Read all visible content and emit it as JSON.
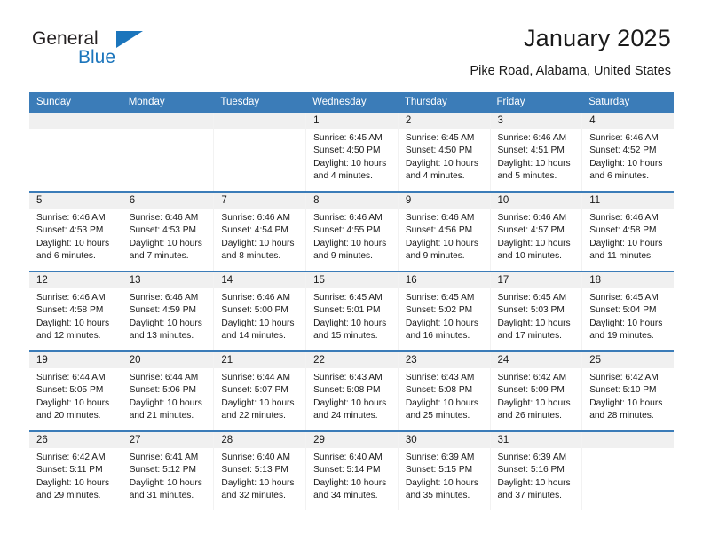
{
  "brand": {
    "name_dark": "General",
    "name_blue": "Blue",
    "accent_color": "#1b75bc"
  },
  "header": {
    "title": "January 2025",
    "location": "Pike Road, Alabama, United States"
  },
  "calendar": {
    "header_bg": "#3b7cb8",
    "daynum_bg": "#f0f0f0",
    "weekdays": [
      "Sunday",
      "Monday",
      "Tuesday",
      "Wednesday",
      "Thursday",
      "Friday",
      "Saturday"
    ],
    "weeks": [
      [
        {
          "day": "",
          "sunrise": "",
          "sunset": "",
          "daylight": "",
          "empty": true
        },
        {
          "day": "",
          "sunrise": "",
          "sunset": "",
          "daylight": "",
          "empty": true
        },
        {
          "day": "",
          "sunrise": "",
          "sunset": "",
          "daylight": "",
          "empty": true
        },
        {
          "day": "1",
          "sunrise": "Sunrise: 6:45 AM",
          "sunset": "Sunset: 4:50 PM",
          "daylight": "Daylight: 10 hours and 4 minutes."
        },
        {
          "day": "2",
          "sunrise": "Sunrise: 6:45 AM",
          "sunset": "Sunset: 4:50 PM",
          "daylight": "Daylight: 10 hours and 4 minutes."
        },
        {
          "day": "3",
          "sunrise": "Sunrise: 6:46 AM",
          "sunset": "Sunset: 4:51 PM",
          "daylight": "Daylight: 10 hours and 5 minutes."
        },
        {
          "day": "4",
          "sunrise": "Sunrise: 6:46 AM",
          "sunset": "Sunset: 4:52 PM",
          "daylight": "Daylight: 10 hours and 6 minutes."
        }
      ],
      [
        {
          "day": "5",
          "sunrise": "Sunrise: 6:46 AM",
          "sunset": "Sunset: 4:53 PM",
          "daylight": "Daylight: 10 hours and 6 minutes."
        },
        {
          "day": "6",
          "sunrise": "Sunrise: 6:46 AM",
          "sunset": "Sunset: 4:53 PM",
          "daylight": "Daylight: 10 hours and 7 minutes."
        },
        {
          "day": "7",
          "sunrise": "Sunrise: 6:46 AM",
          "sunset": "Sunset: 4:54 PM",
          "daylight": "Daylight: 10 hours and 8 minutes."
        },
        {
          "day": "8",
          "sunrise": "Sunrise: 6:46 AM",
          "sunset": "Sunset: 4:55 PM",
          "daylight": "Daylight: 10 hours and 9 minutes."
        },
        {
          "day": "9",
          "sunrise": "Sunrise: 6:46 AM",
          "sunset": "Sunset: 4:56 PM",
          "daylight": "Daylight: 10 hours and 9 minutes."
        },
        {
          "day": "10",
          "sunrise": "Sunrise: 6:46 AM",
          "sunset": "Sunset: 4:57 PM",
          "daylight": "Daylight: 10 hours and 10 minutes."
        },
        {
          "day": "11",
          "sunrise": "Sunrise: 6:46 AM",
          "sunset": "Sunset: 4:58 PM",
          "daylight": "Daylight: 10 hours and 11 minutes."
        }
      ],
      [
        {
          "day": "12",
          "sunrise": "Sunrise: 6:46 AM",
          "sunset": "Sunset: 4:58 PM",
          "daylight": "Daylight: 10 hours and 12 minutes."
        },
        {
          "day": "13",
          "sunrise": "Sunrise: 6:46 AM",
          "sunset": "Sunset: 4:59 PM",
          "daylight": "Daylight: 10 hours and 13 minutes."
        },
        {
          "day": "14",
          "sunrise": "Sunrise: 6:46 AM",
          "sunset": "Sunset: 5:00 PM",
          "daylight": "Daylight: 10 hours and 14 minutes."
        },
        {
          "day": "15",
          "sunrise": "Sunrise: 6:45 AM",
          "sunset": "Sunset: 5:01 PM",
          "daylight": "Daylight: 10 hours and 15 minutes."
        },
        {
          "day": "16",
          "sunrise": "Sunrise: 6:45 AM",
          "sunset": "Sunset: 5:02 PM",
          "daylight": "Daylight: 10 hours and 16 minutes."
        },
        {
          "day": "17",
          "sunrise": "Sunrise: 6:45 AM",
          "sunset": "Sunset: 5:03 PM",
          "daylight": "Daylight: 10 hours and 17 minutes."
        },
        {
          "day": "18",
          "sunrise": "Sunrise: 6:45 AM",
          "sunset": "Sunset: 5:04 PM",
          "daylight": "Daylight: 10 hours and 19 minutes."
        }
      ],
      [
        {
          "day": "19",
          "sunrise": "Sunrise: 6:44 AM",
          "sunset": "Sunset: 5:05 PM",
          "daylight": "Daylight: 10 hours and 20 minutes."
        },
        {
          "day": "20",
          "sunrise": "Sunrise: 6:44 AM",
          "sunset": "Sunset: 5:06 PM",
          "daylight": "Daylight: 10 hours and 21 minutes."
        },
        {
          "day": "21",
          "sunrise": "Sunrise: 6:44 AM",
          "sunset": "Sunset: 5:07 PM",
          "daylight": "Daylight: 10 hours and 22 minutes."
        },
        {
          "day": "22",
          "sunrise": "Sunrise: 6:43 AM",
          "sunset": "Sunset: 5:08 PM",
          "daylight": "Daylight: 10 hours and 24 minutes."
        },
        {
          "day": "23",
          "sunrise": "Sunrise: 6:43 AM",
          "sunset": "Sunset: 5:08 PM",
          "daylight": "Daylight: 10 hours and 25 minutes."
        },
        {
          "day": "24",
          "sunrise": "Sunrise: 6:42 AM",
          "sunset": "Sunset: 5:09 PM",
          "daylight": "Daylight: 10 hours and 26 minutes."
        },
        {
          "day": "25",
          "sunrise": "Sunrise: 6:42 AM",
          "sunset": "Sunset: 5:10 PM",
          "daylight": "Daylight: 10 hours and 28 minutes."
        }
      ],
      [
        {
          "day": "26",
          "sunrise": "Sunrise: 6:42 AM",
          "sunset": "Sunset: 5:11 PM",
          "daylight": "Daylight: 10 hours and 29 minutes."
        },
        {
          "day": "27",
          "sunrise": "Sunrise: 6:41 AM",
          "sunset": "Sunset: 5:12 PM",
          "daylight": "Daylight: 10 hours and 31 minutes."
        },
        {
          "day": "28",
          "sunrise": "Sunrise: 6:40 AM",
          "sunset": "Sunset: 5:13 PM",
          "daylight": "Daylight: 10 hours and 32 minutes."
        },
        {
          "day": "29",
          "sunrise": "Sunrise: 6:40 AM",
          "sunset": "Sunset: 5:14 PM",
          "daylight": "Daylight: 10 hours and 34 minutes."
        },
        {
          "day": "30",
          "sunrise": "Sunrise: 6:39 AM",
          "sunset": "Sunset: 5:15 PM",
          "daylight": "Daylight: 10 hours and 35 minutes."
        },
        {
          "day": "31",
          "sunrise": "Sunrise: 6:39 AM",
          "sunset": "Sunset: 5:16 PM",
          "daylight": "Daylight: 10 hours and 37 minutes."
        },
        {
          "day": "",
          "sunrise": "",
          "sunset": "",
          "daylight": "",
          "empty": true
        }
      ]
    ]
  }
}
